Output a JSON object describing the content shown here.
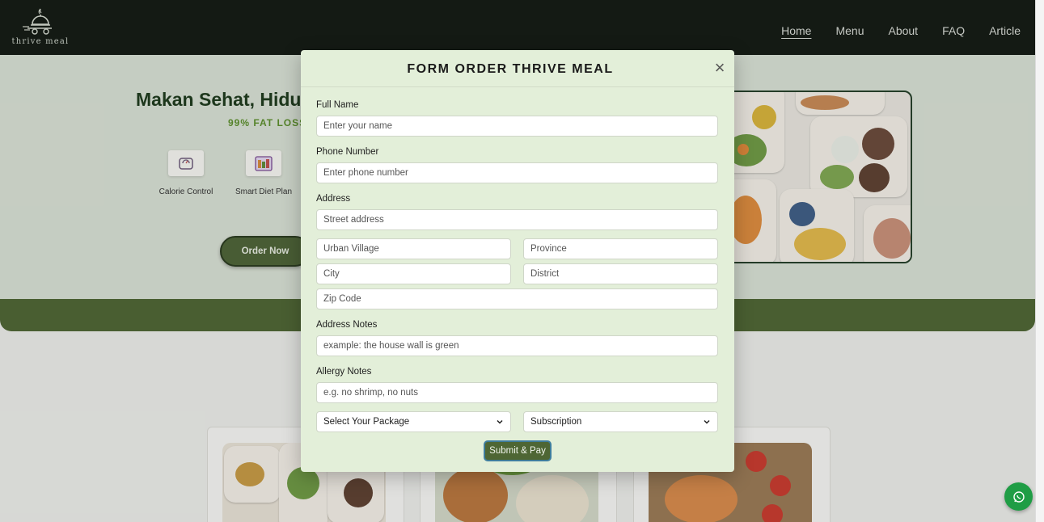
{
  "brand": {
    "name": "thrive meal"
  },
  "nav": {
    "items": [
      "Home",
      "Menu",
      "About",
      "FAQ",
      "Article"
    ],
    "active": "Home"
  },
  "hero": {
    "title": "Makan Sehat, Hidu",
    "subtitle": "99% FAT LOSS",
    "features": [
      {
        "label": "Calorie Control",
        "icon": "scale-icon"
      },
      {
        "label": "Smart Diet Plan",
        "icon": "diet-plan-icon"
      }
    ],
    "order_button": "Order Now"
  },
  "modal": {
    "title": "FORM ORDER THRIVE MEAL",
    "close_glyph": "×",
    "full_name": {
      "label": "Full Name",
      "placeholder": "Enter your name"
    },
    "phone": {
      "label": "Phone Number",
      "placeholder": "Enter phone number"
    },
    "address": {
      "label": "Address",
      "street_placeholder": "Street address",
      "urban_village_placeholder": "Urban Village",
      "province_placeholder": "Province",
      "city_placeholder": "City",
      "district_placeholder": "District",
      "zip_placeholder": "Zip Code"
    },
    "address_notes": {
      "label": "Address Notes",
      "placeholder": "example: the house wall is green"
    },
    "allergy_notes": {
      "label": "Allergy Notes",
      "placeholder": "e.g. no shrimp, no nuts"
    },
    "package_select": {
      "value": "Select Your Package"
    },
    "subscription_select": {
      "value": "Subscription"
    },
    "submit_label": "Submit & Pay"
  },
  "colors": {
    "header_bg": "#131a13",
    "accent_green": "#4e6634",
    "modal_bg": "#e3efd9",
    "whatsapp_green": "#1f9d45"
  }
}
